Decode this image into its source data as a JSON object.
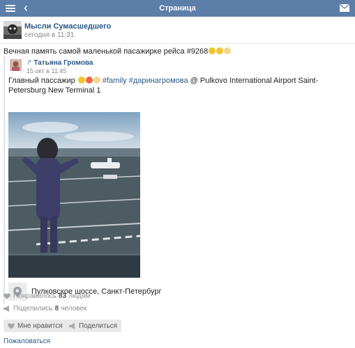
{
  "topbar": {
    "title": "Страница",
    "menu_icon": "menu-icon",
    "back_icon": "back-chevron-icon",
    "mail_icon": "mail-icon",
    "color": "#5c7ea8"
  },
  "post": {
    "author": "Мысли Сумасшедшего",
    "time": "сегодня в 11:31",
    "text": "Вечная память самой маленькой пасажирке рейса #9268"
  },
  "repost": {
    "share_icon": "repost-icon",
    "author": "Татьяна Громова",
    "time": "15 окт в 11:45",
    "text_prefix": "Главный пассажир ",
    "tags": "#family #даринагромова",
    "text_suffix": " @ Pulkovo International Airport Saint-Petersburg New Terminal 1",
    "location": "Пулковское шоссе, Санкт-Петербург",
    "location_icon": "location-pin-icon"
  },
  "stats": {
    "likes_prefix": "Понравилось",
    "likes_count": "83",
    "likes_suffix": "людям",
    "shares_prefix": "Поделились",
    "shares_count": "8",
    "shares_suffix": "человек"
  },
  "actions": {
    "like": "Мне нравится",
    "share": "Поделиться",
    "report": "Пожаловаться"
  },
  "colors": {
    "link": "#2b5787",
    "muted": "#8b8b8b"
  }
}
